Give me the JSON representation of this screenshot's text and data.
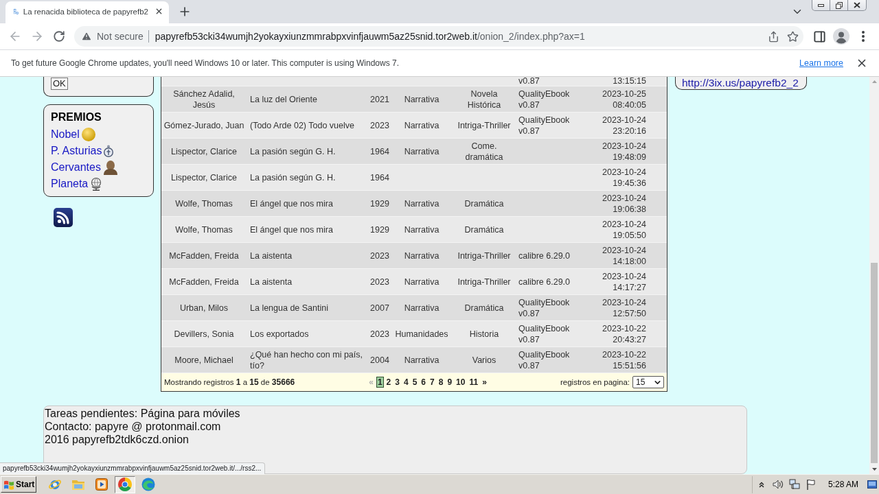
{
  "browser": {
    "tabs": [
      {
        "title": "La renacida biblioteca de papyrefb2",
        "selected": true
      }
    ],
    "back": {
      "disabled": true
    },
    "forward": {
      "disabled": true
    },
    "address_bar": {
      "security_label": "Not secure",
      "host": "papyrefb53cki34wumjh2yokayxiunzmmrabpxvinfjauwm5az25snid.tor2web.it",
      "path": "/onion_2/index.php?ax=1"
    }
  },
  "infobar": {
    "message": "To get future Google Chrome updates, you'll need Windows 10 or later. This computer is using Windows 7.",
    "link": "Learn more"
  },
  "left_sidebar": {
    "ok_button": "OK",
    "awards": {
      "heading": "PREMIOS",
      "items": [
        {
          "label": "Nobel",
          "kind": "medal"
        },
        {
          "label": "P. Asturias",
          "kind": "medallion"
        },
        {
          "label": "Cervantes",
          "kind": "bust"
        },
        {
          "label": "Planeta",
          "kind": "globe"
        }
      ]
    }
  },
  "table": {
    "cut_row": {
      "column_6": "v0.87",
      "column_7": "13:15:15"
    },
    "rows": [
      {
        "column_1": "Sánchez Adalid, Jesús",
        "column_2": "La luz del Oriente",
        "column_3": "2021",
        "column_4": "Narrativa",
        "column_5": "Novela Histórica",
        "column_6": "QualityEbook v0.87",
        "column_7": "2023-10-25 08:40:05"
      },
      {
        "column_1": "Gómez-Jurado, Juan",
        "column_2": "(Todo Arde 02) Todo vuelve",
        "column_3": "2023",
        "column_4": "Narrativa",
        "column_5": "Intriga-Thriller",
        "column_6": "QualityEbook v0.87",
        "column_7": "2023-10-24 23:20:16"
      },
      {
        "column_1": "Lispector, Clarice",
        "column_2": "La pasión según G. H.",
        "column_3": "1964",
        "column_4": "Narrativa",
        "column_5": "Come. dramática",
        "column_7": "2023-10-24 19:48:09"
      },
      {
        "column_1": "Lispector, Clarice",
        "column_2": "La pasión según G. H.",
        "column_3": "1964",
        "column_7": "2023-10-24 19:45:36"
      },
      {
        "column_1": "Wolfe, Thomas",
        "column_2": "El ángel que nos mira",
        "column_3": "1929",
        "column_4": "Narrativa",
        "column_5": "Dramática",
        "column_7": "2023-10-24 19:06:38"
      },
      {
        "column_1": "Wolfe, Thomas",
        "column_2": "El ángel que nos mira",
        "column_3": "1929",
        "column_4": "Narrativa",
        "column_5": "Dramática",
        "column_7": "2023-10-24 19:05:50"
      },
      {
        "column_1": "McFadden, Freida",
        "column_2": "La aistenta",
        "column_3": "2023",
        "column_4": "Narrativa",
        "column_5": "Intriga-Thriller",
        "column_6": "calibre 6.29.0",
        "column_7": "2023-10-24 14:18:00"
      },
      {
        "column_1": "McFadden, Freida",
        "column_2": "La aistenta",
        "column_3": "2023",
        "column_4": "Narrativa",
        "column_5": "Intriga-Thriller",
        "column_6": "calibre 6.29.0",
        "column_7": "2023-10-24 14:17:27"
      },
      {
        "column_1": "Urban, Milos",
        "column_2": "La lengua de Santini",
        "column_3": "2007",
        "column_4": "Narrativa",
        "column_5": "Dramática",
        "column_6": "QualityEbook v0.87",
        "column_7": "2023-10-24 12:57:50"
      },
      {
        "column_1": "Devillers, Sonia",
        "column_2": "Los exportados",
        "column_3": "2023",
        "column_4": "Humanidades",
        "column_5": "Historia",
        "column_6": "QualityEbook v0.87",
        "column_7": "2023-10-22 20:43:27"
      },
      {
        "column_1": "Moore, Michael",
        "column_2": "¿Qué han hecho con mi país, tío?",
        "column_3": "2004",
        "column_4": "Narrativa",
        "column_5": "Varios",
        "column_6": "QualityEbook v0.87",
        "column_7": "2023-10-22 15:51:56"
      }
    ],
    "pagination": {
      "summary": "Mostrando registros **1** a **15** de **35666**",
      "previous": {
        "label": "«",
        "disabled": true
      },
      "pages": [
        {
          "label": "1",
          "selected": true
        },
        {
          "label": "2",
          "selected": false
        },
        {
          "label": "3",
          "selected": false
        },
        {
          "label": "4",
          "selected": false
        },
        {
          "label": "5",
          "selected": false
        },
        {
          "label": "6",
          "selected": false
        },
        {
          "label": "7",
          "selected": false
        },
        {
          "label": "8",
          "selected": false
        },
        {
          "label": "9",
          "selected": false
        },
        {
          "label": "10",
          "selected": false
        },
        {
          "label": "11",
          "selected": false
        }
      ],
      "next": {
        "label": "»",
        "disabled": false
      },
      "per_page_label": "registros en pagina:",
      "per_page": "15"
    }
  },
  "right_sidebar": {
    "link": "http://3ix.us/papyrefb2_2"
  },
  "footer": {
    "lines": [
      "Tareas pendientes: Página para móviles",
      "Contacto: papyre @ protonmail.com",
      "2016 papyrefb2tdk6czd.onion"
    ]
  },
  "status_bubble": "papyrefb53cki34wumjh2yokayxiunzmmrabpxvinfjauwm5az25snid.tor2web.it/.../rss2...",
  "taskbar": {
    "start": "Start",
    "apps": [
      {
        "kind": "orbit",
        "selected": false
      },
      {
        "kind": "folder",
        "selected": false
      },
      {
        "kind": "player",
        "selected": false
      },
      {
        "kind": "browser",
        "selected": true
      },
      {
        "kind": "swirl",
        "selected": false
      }
    ],
    "clock": "5:28 AM"
  }
}
